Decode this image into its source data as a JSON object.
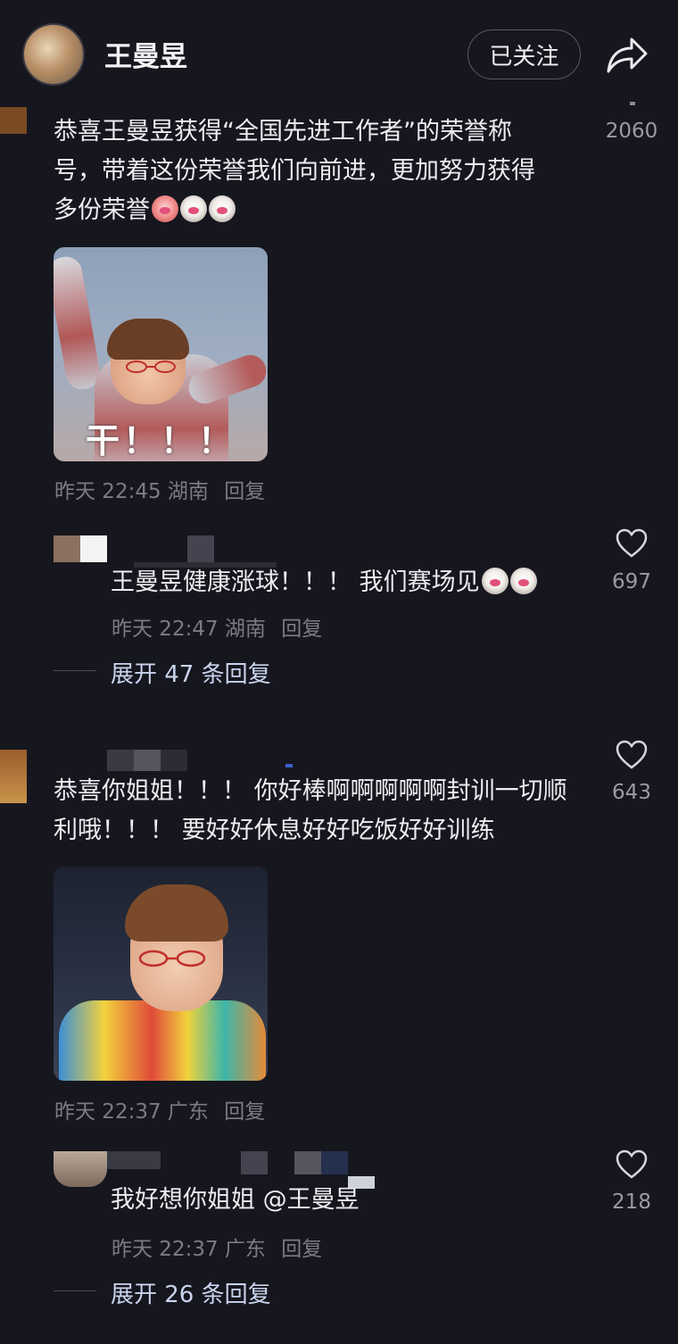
{
  "header": {
    "title": "王曼昱",
    "follow_label": "已关注"
  },
  "comments": [
    {
      "text_lines": [
        "恭喜王曼昱获得“全国先进工作者”的荣誉称",
        "号，带着这份荣誉我们向前进，更加努力获得",
        "多份荣誉"
      ],
      "likes": "2060",
      "image_caption": "干！！！",
      "time": "昨天 22:45",
      "location": "湖南",
      "reply_label": "回复",
      "sub_reply": {
        "text": "王曼昱健康涨球！！！ 我们赛场见",
        "likes": "697",
        "time": "昨天 22:47",
        "location": "湖南",
        "reply_label": "回复"
      },
      "expand_label": "展开 47 条回复"
    },
    {
      "text_lines": [
        "恭喜你姐姐！！！ 你好棒啊啊啊啊啊封训一切顺",
        "利哦！！！ 要好好休息好好吃饭好好训练"
      ],
      "likes": "643",
      "time": "昨天 22:37",
      "location": "广东",
      "reply_label": "回复",
      "sub_reply": {
        "text": "我好想你姐姐 @王曼昱",
        "likes": "218",
        "time": "昨天 22:37",
        "location": "广东",
        "reply_label": "回复"
      },
      "expand_label": "展开 26 条回复"
    }
  ],
  "icons": {
    "share": "share-arrow-icon",
    "like": "heart-outline-icon"
  }
}
